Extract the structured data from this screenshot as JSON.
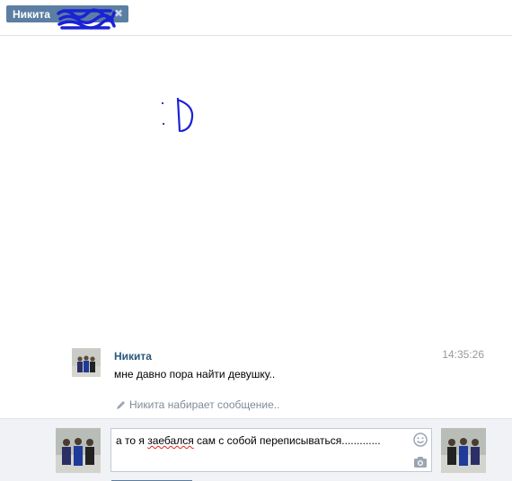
{
  "tab": {
    "name": "Никита",
    "close_glyph": "✖"
  },
  "drawing": {
    "icon": "hand-drawn-smiley",
    "color": "#1a22d6"
  },
  "message": {
    "author": "Никита",
    "time": "14:35:26",
    "text": "мне давно пора найти девушку.."
  },
  "typing": {
    "text": "Никита набирает сообщение..",
    "icon": "pencil-icon"
  },
  "composer": {
    "value_before": "а то я ",
    "value_misspelled": "заебался",
    "value_after": " сам с собой переписываться.............",
    "icons": [
      "smile-icon",
      "camera-icon"
    ]
  },
  "colors": {
    "accent": "#5b7ea3",
    "author": "#2b587a",
    "scribble": "#1a22d6"
  }
}
